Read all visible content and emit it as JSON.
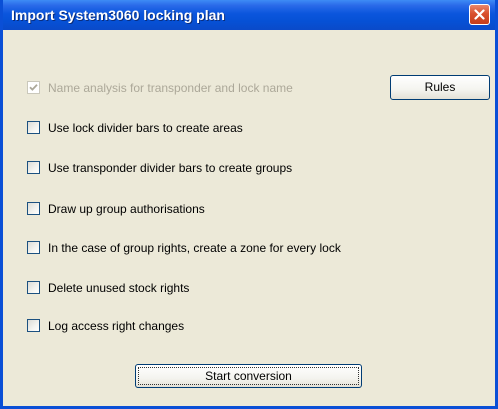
{
  "window": {
    "title": "Import System3060 locking plan"
  },
  "options": [
    {
      "label": "Name analysis for transponder and lock name",
      "checked": true,
      "enabled": false
    },
    {
      "label": "Use lock divider bars to create areas",
      "checked": false,
      "enabled": true
    },
    {
      "label": "Use transponder divider bars to create groups",
      "checked": false,
      "enabled": true
    },
    {
      "label": "Draw up group authorisations",
      "checked": false,
      "enabled": true
    },
    {
      "label": "In the case of group rights, create a zone for every lock",
      "checked": false,
      "enabled": true
    },
    {
      "label": "Delete unused stock rights",
      "checked": false,
      "enabled": true
    },
    {
      "label": "Log access right changes",
      "checked": false,
      "enabled": true
    }
  ],
  "buttons": {
    "rules": "Rules",
    "start": "Start conversion"
  },
  "icons": {
    "close": "close-icon",
    "checkmark": "checkmark-icon"
  },
  "colors": {
    "titlebar": "#0651d6",
    "close_button": "#d9502d",
    "dialog_background": "#ece9d8",
    "disabled_text": "#aca899"
  }
}
